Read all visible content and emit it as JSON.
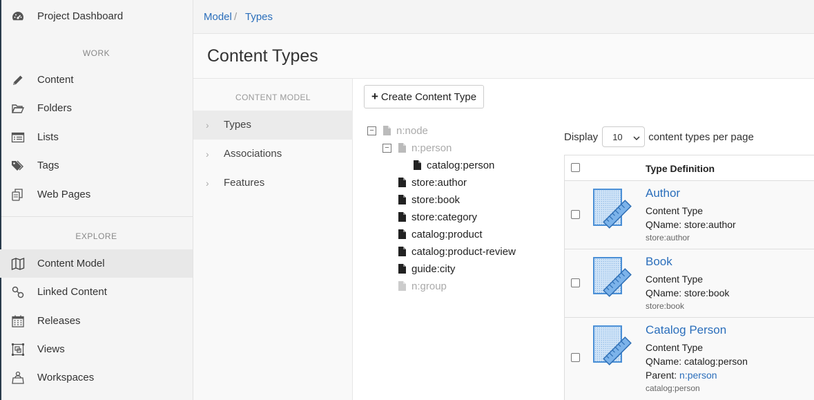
{
  "sidebar": {
    "top_item": {
      "label": "Project Dashboard",
      "icon": "dashboard-icon"
    },
    "work_heading": "WORK",
    "work_items": [
      {
        "label": "Content",
        "icon": "pencil-icon"
      },
      {
        "label": "Folders",
        "icon": "folder-open-icon"
      },
      {
        "label": "Lists",
        "icon": "list-icon"
      },
      {
        "label": "Tags",
        "icon": "tags-icon"
      },
      {
        "label": "Web Pages",
        "icon": "web-pages-icon"
      }
    ],
    "explore_heading": "EXPLORE",
    "explore_items": [
      {
        "label": "Content Model",
        "icon": "map-icon",
        "active": true
      },
      {
        "label": "Linked Content",
        "icon": "link-icon"
      },
      {
        "label": "Releases",
        "icon": "calendar-icon"
      },
      {
        "label": "Views",
        "icon": "views-icon"
      },
      {
        "label": "Workspaces",
        "icon": "workspaces-icon"
      }
    ]
  },
  "breadcrumb": {
    "items": [
      "Model",
      "Types"
    ],
    "separator": "/"
  },
  "page": {
    "title": "Content Types"
  },
  "subnav": {
    "heading": "CONTENT MODEL",
    "items": [
      {
        "label": "Types",
        "active": true
      },
      {
        "label": "Associations"
      },
      {
        "label": "Features"
      }
    ]
  },
  "toolbar": {
    "create_label": "Create Content Type"
  },
  "tree": [
    {
      "label": "n:node",
      "toggle": "−",
      "muted": true
    },
    {
      "label": "n:person",
      "toggle": "−",
      "muted": true
    },
    {
      "label": "catalog:person"
    },
    {
      "label": "store:author"
    },
    {
      "label": "store:book"
    },
    {
      "label": "store:category"
    },
    {
      "label": "catalog:product"
    },
    {
      "label": "catalog:product-review"
    },
    {
      "label": "guide:city"
    },
    {
      "label": "n:group",
      "muted": true
    }
  ],
  "pagination": {
    "display_label": "Display",
    "per_page": "10",
    "suffix": "content types per page"
  },
  "table": {
    "header": "Type Definition",
    "rows": [
      {
        "name": "Author",
        "type": "Content Type",
        "qname": "QName: store:author",
        "id": "store:author"
      },
      {
        "name": "Book",
        "type": "Content Type",
        "qname": "QName: store:book",
        "id": "store:book"
      },
      {
        "name": "Catalog Person",
        "type": "Content Type",
        "qname": "QName: catalog:person",
        "parent_label": "Parent:",
        "parent": "n:person",
        "id": "catalog:person"
      }
    ]
  },
  "colors": {
    "link": "#2a6ebb",
    "thumb_fill": "#cfe3f7",
    "thumb_stroke": "#4a8fd6"
  }
}
